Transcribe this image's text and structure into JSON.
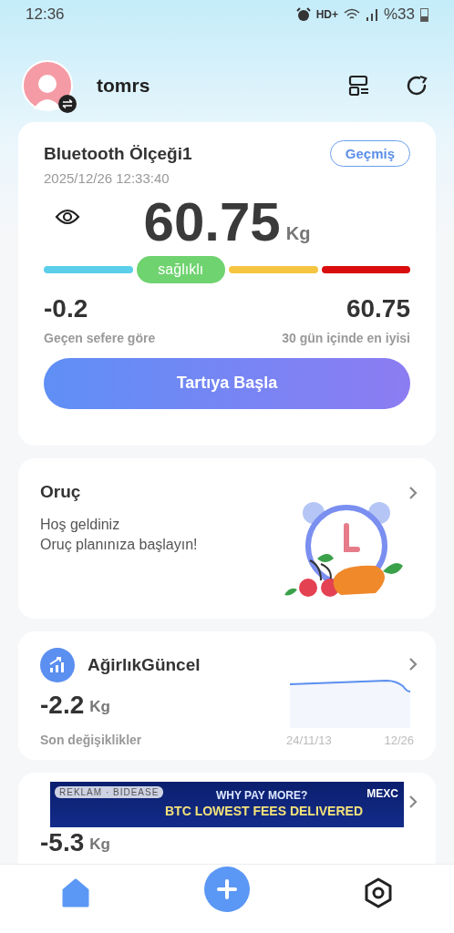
{
  "status_bar": {
    "time": "12:36",
    "network": "HD+",
    "battery": "%33"
  },
  "header": {
    "user": "tomrs"
  },
  "scale_card": {
    "title": "Bluetooth Ölçeği1",
    "history_button": "Geçmiş",
    "datetime": "2025/12/26 12:33:40",
    "weight": "60.75",
    "unit": "Kg",
    "ranges": [
      {
        "color": "#5bcfea",
        "selected": false
      },
      {
        "color": "#6fd36f",
        "selected": true,
        "label": "sağlıklı"
      },
      {
        "color": "#f5c542",
        "selected": false
      },
      {
        "color": "#d90d0d",
        "selected": false
      }
    ],
    "change_value": "-0.2",
    "change_label": "Geçen sefere göre",
    "best_value": "60.75",
    "best_label": "30 gün içinde en iyisi",
    "start_button": "Tartıya Başla"
  },
  "fasting_card": {
    "title": "Oruç",
    "lines": [
      "Hoş geldiniz",
      "Oruç planınıza başlayın!"
    ]
  },
  "trend_card": {
    "title": "AğirlıkGüncel",
    "value": "-2.2",
    "unit": "Kg",
    "caption": "Son değişiklikler",
    "x_start": "24/11/13",
    "x_end": "12/26"
  },
  "next_card": {
    "value": "-5.3",
    "unit": "Kg"
  },
  "ad": {
    "tag": "REKLAM · BIDEASE",
    "headline": "WHY PAY MORE?",
    "subline": "BTC LOWEST FEES DELIVERED",
    "brand": "MEXC"
  },
  "bottom_nav": [
    {
      "kind": "home",
      "selected": true
    },
    {
      "kind": "add",
      "selected": false
    },
    {
      "kind": "settings",
      "selected": false
    }
  ]
}
